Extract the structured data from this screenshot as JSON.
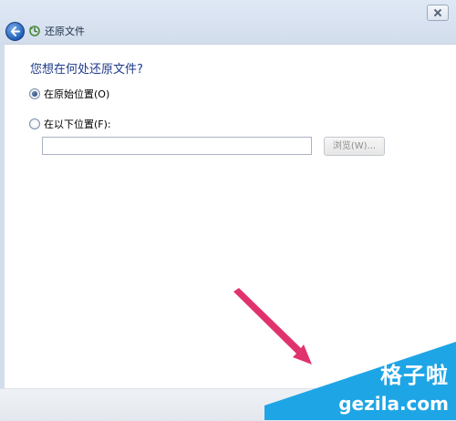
{
  "window": {
    "title": "还原文件"
  },
  "main": {
    "heading": "您想在何处还原文件?",
    "options": [
      {
        "label": "在原始位置(O)",
        "selected": true
      },
      {
        "label": "在以下位置(F):",
        "selected": false
      }
    ],
    "path_input": {
      "value": "",
      "placeholder": ""
    },
    "browse_label": "浏览(W)..."
  },
  "icons": {
    "back": "back-arrow-icon",
    "title": "restore-files-icon",
    "close": "close-icon"
  },
  "watermark": {
    "name": "格子啦",
    "url": "gezila.com"
  },
  "colors": {
    "heading": "#1e3a8a",
    "arrow": "#e0336e",
    "watermark": "#1ea5e6"
  }
}
